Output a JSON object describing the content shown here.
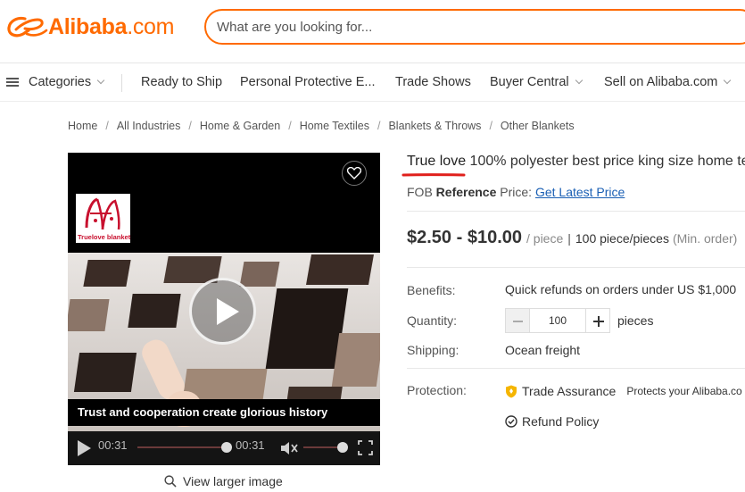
{
  "header": {
    "logo_brand": "Alibaba",
    "logo_suffix": ".com",
    "search_placeholder": "What are you looking for..."
  },
  "nav": {
    "items": [
      {
        "label": "Categories",
        "dropdown": true
      },
      {
        "label": "Ready to Ship",
        "dropdown": false
      },
      {
        "label": "Personal Protective E...",
        "dropdown": false
      },
      {
        "label": "Trade Shows",
        "dropdown": false
      },
      {
        "label": "Buyer Central",
        "dropdown": true
      },
      {
        "label": "Sell on Alibaba.com",
        "dropdown": true
      }
    ]
  },
  "breadcrumb": [
    "Home",
    "All Industries",
    "Home & Garden",
    "Home Textiles",
    "Blankets & Throws",
    "Other Blankets"
  ],
  "media": {
    "brand_logo_text": "Truelove blanket",
    "caption": "Trust and cooperation create glorious history",
    "time_current": "00:31",
    "time_total": "00:31",
    "view_larger": "View larger image"
  },
  "product": {
    "title_brand": "True love",
    "title_rest": " 100% polyester best price king size home te",
    "fob_prefix": "FOB ",
    "fob_bold": "Reference",
    "fob_suffix": " Price: ",
    "fob_link": "Get Latest Price",
    "price": "$2.50 - $10.00",
    "price_unit": "/ piece",
    "moq": "100 piece/pieces",
    "moq_note": "(Min. order)",
    "benefits_label": "Benefits:",
    "benefits_value": "Quick refunds on orders under US $1,000",
    "quantity_label": "Quantity:",
    "quantity_value": "100",
    "quantity_unit": "pieces",
    "shipping_label": "Shipping:",
    "shipping_value": "Ocean freight",
    "protection_label": "Protection:",
    "trade_assurance": "Trade Assurance",
    "trade_assurance_note": "Protects your Alibaba.co",
    "refund_policy": "Refund Policy"
  },
  "colors": {
    "brand_orange": "#ff6a00",
    "link_blue": "#1a5fb4",
    "annotation_red": "#e0201c"
  }
}
